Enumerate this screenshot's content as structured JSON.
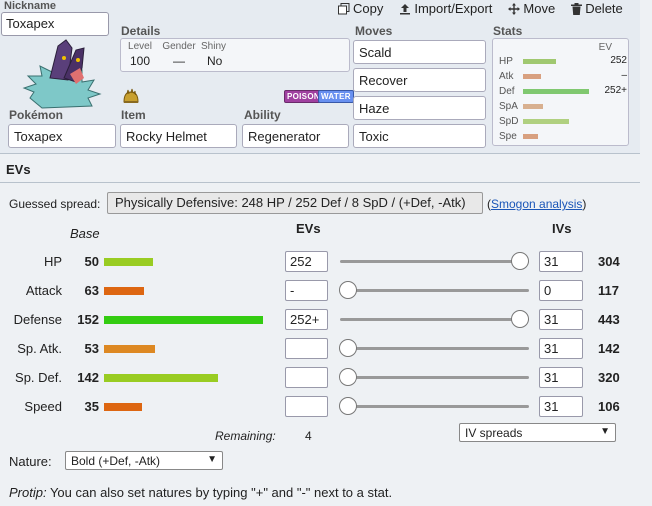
{
  "nickname": {
    "label": "Nickname",
    "value": "Toxapex"
  },
  "toolbar": {
    "copy": "Copy",
    "import_export": "Import/Export",
    "move": "Move",
    "delete": "Delete"
  },
  "details": {
    "title": "Details",
    "level_label": "Level",
    "level": "100",
    "gender_label": "Gender",
    "gender": "—",
    "shiny_label": "Shiny",
    "shiny": "No"
  },
  "types": [
    {
      "name": "POISON",
      "color": "#a040a0"
    },
    {
      "name": "WATER",
      "color": "#6890f0"
    }
  ],
  "pokemon": {
    "label": "Pokémon",
    "value": "Toxapex"
  },
  "item": {
    "label": "Item",
    "value": "Rocky Helmet"
  },
  "ability": {
    "label": "Ability",
    "value": "Regenerator"
  },
  "moves": {
    "title": "Moves",
    "list": [
      "Scald",
      "Recover",
      "Haze",
      "Toxic"
    ]
  },
  "stats_panel": {
    "title": "Stats",
    "ev_header": "EV",
    "rows": [
      {
        "name": "HP",
        "ev": "252",
        "fill": 0.5,
        "color": "#a0c870"
      },
      {
        "name": "Atk",
        "ev": "–",
        "fill": 0.28,
        "color": "#d8a080"
      },
      {
        "name": "Def",
        "ev": "252+",
        "fill": 1.0,
        "color": "#80c870"
      },
      {
        "name": "SpA",
        "ev": "",
        "fill": 0.3,
        "color": "#d8b090"
      },
      {
        "name": "SpD",
        "ev": "",
        "fill": 0.7,
        "color": "#b0d080"
      },
      {
        "name": "Spe",
        "ev": "",
        "fill": 0.23,
        "color": "#d8a080"
      }
    ]
  },
  "evs_section": {
    "title": "EVs",
    "guess_label": "Guessed spread:",
    "guess_value": "Physically Defensive: 248 HP / 252 Def / 8 SpD / (+Def, -Atk)",
    "smogon_open": "(",
    "smogon_link": "Smogon analysis",
    "smogon_close": ")",
    "base_header": "Base",
    "evs_header": "EVs",
    "ivs_header": "IVs",
    "stats": [
      {
        "label": "HP",
        "base": "50",
        "ev": "252",
        "iv": "31",
        "total": "304",
        "bar_fill": 0.31,
        "bar_color": "#99cc22",
        "slider": 1.0
      },
      {
        "label": "Attack",
        "base": "63",
        "ev": "-",
        "iv": "0",
        "total": "117",
        "bar_fill": 0.25,
        "bar_color": "#dd6611",
        "slider": 0
      },
      {
        "label": "Defense",
        "base": "152",
        "ev": "252+",
        "iv": "31",
        "total": "443",
        "bar_fill": 1.0,
        "bar_color": "#33cc11",
        "slider": 1.0
      },
      {
        "label": "Sp. Atk.",
        "base": "53",
        "ev": "",
        "iv": "31",
        "total": "142",
        "bar_fill": 0.32,
        "bar_color": "#dd8822",
        "slider": 0
      },
      {
        "label": "Sp. Def.",
        "base": "142",
        "ev": "",
        "iv": "31",
        "total": "320",
        "bar_fill": 0.72,
        "bar_color": "#99cc22",
        "slider": 0
      },
      {
        "label": "Speed",
        "base": "35",
        "ev": "",
        "iv": "31",
        "total": "106",
        "bar_fill": 0.24,
        "bar_color": "#dd6611",
        "slider": 0
      }
    ],
    "remaining_label": "Remaining:",
    "remaining_value": "4",
    "iv_spreads": "IV spreads",
    "nature_label": "Nature:",
    "nature_value": "Bold (+Def, -Atk)",
    "protip_label": "Protip:",
    "protip_text": " You can also set natures by typing \"+\" and \"-\" next to a stat."
  }
}
